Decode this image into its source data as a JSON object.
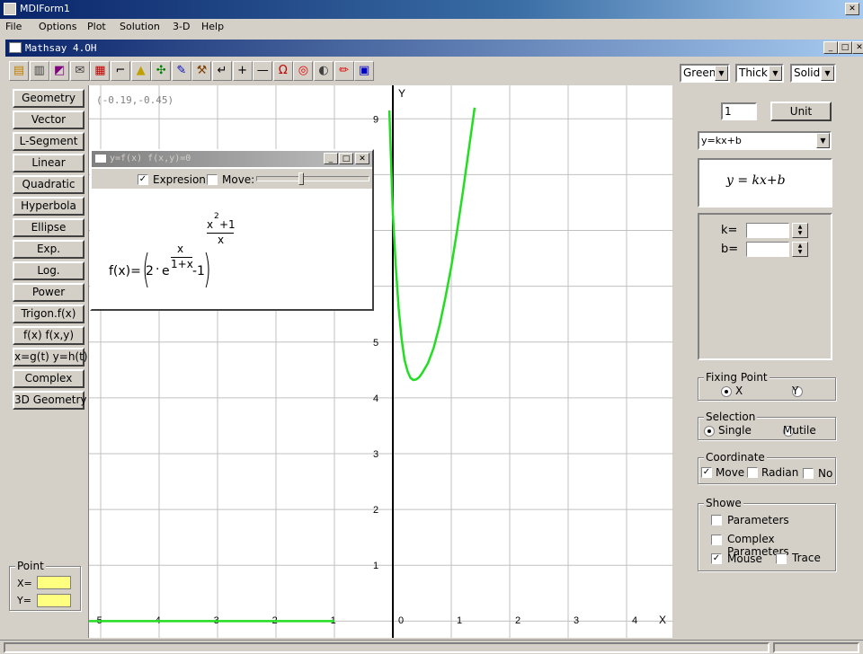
{
  "app": {
    "title": "MDIForm1",
    "menu": [
      "File",
      "Options",
      "Plot",
      "Solution",
      "3-D",
      "Help"
    ],
    "child_title": "Mathsay 4.OH"
  },
  "toolbar_icons": [
    "new-icon",
    "save-icon",
    "plot-icon",
    "table-icon",
    "graph-paper-icon",
    "axes-icon",
    "triangle-icon",
    "cross-arrows-icon",
    "pen-icon",
    "tool-icon",
    "return-arrow-icon",
    "plus-icon",
    "minus-icon",
    "omega-icon",
    "target-icon",
    "contrast-icon",
    "pencil-icon",
    "window-icon"
  ],
  "style_controls": {
    "color": "Green",
    "thickness": "Thick",
    "line_style": "Solid"
  },
  "sidebar": {
    "buttons": [
      "Geometry",
      "Vector",
      "L-Segment",
      "Linear",
      "Quadratic",
      "Hyperbola",
      "Ellipse",
      "Exp.",
      "Log.",
      "Power",
      "Trigon.f(x)",
      "f(x)  f(x,y)",
      "x=g(t) y=h(t)",
      "Complex",
      "3D Geometry"
    ]
  },
  "point_group": {
    "title": "Point",
    "x_label": "X=",
    "y_label": "Y=",
    "x_value": "",
    "y_value": ""
  },
  "graph": {
    "coord_readout": "(-0.19,-0.45)",
    "x_axis_label": "X",
    "y_axis_label": "Y",
    "x_ticks": [
      "-5",
      "-4",
      "-3",
      "-2",
      "-1",
      "0",
      "1",
      "2",
      "3",
      "4"
    ],
    "y_ticks": [
      "1",
      "2",
      "3",
      "4",
      "5",
      "9"
    ],
    "curve_color": "#22dd22"
  },
  "chart_data": {
    "type": "line",
    "xlim": [
      -5.2,
      4.8
    ],
    "ylim": [
      -0.3,
      9.6
    ],
    "series": [
      {
        "x": [
          -0.06,
          0,
          0.05,
          0.1,
          0.15,
          0.2,
          0.25,
          0.3,
          0.35,
          0.4,
          0.45,
          0.5,
          0.6,
          0.7,
          0.8,
          0.9,
          1.0,
          1.1,
          1.2,
          1.3,
          1.4
        ],
        "y": [
          9.15,
          7.3,
          6.35,
          5.6,
          5.05,
          4.68,
          4.48,
          4.36,
          4.32,
          4.33,
          4.37,
          4.44,
          4.62,
          4.9,
          5.3,
          5.8,
          6.35,
          7.0,
          7.7,
          8.45,
          9.2
        ]
      },
      {
        "x": [
          -5.2,
          -1.0
        ],
        "y": [
          0,
          0
        ]
      }
    ]
  },
  "function_window": {
    "title": "y=f(x)  f(x,y)=0",
    "expression_label": "Expresion",
    "expression_checked": true,
    "move_label": "Move:",
    "move_checked": false,
    "formula_prefix": "f(x)=",
    "base_coef": "2",
    "base_e": "e",
    "inner_num": "x",
    "inner_den": "1+x",
    "minus_one": "-1",
    "outer_num": "x",
    "outer_num_exp": "2",
    "outer_num_add": "+1",
    "outer_den": "x"
  },
  "right_panel": {
    "param_value": "1",
    "unit_button": "Unit",
    "equation_select": "y=kx+b",
    "equation_display": "y = kx+b",
    "k_label": "k=",
    "b_label": "b=",
    "k_value": "",
    "b_value": ""
  },
  "fixing_point": {
    "title": "Fixing Point",
    "x": "X",
    "y": "Y",
    "selected": "X"
  },
  "selection": {
    "title": "Selection",
    "single": "Single",
    "multiple": "Mutile",
    "selected": "Single"
  },
  "coordinate": {
    "title": "Coordinate",
    "move": "Move",
    "radian": "Radian",
    "no": "No",
    "move_checked": true,
    "radian_checked": false,
    "no_checked": false
  },
  "showe": {
    "title": "Showe",
    "parameters": "Parameters",
    "complex_parameters": "Complex Parameters",
    "mouse": "Mouse",
    "trace": "Trace"
  }
}
